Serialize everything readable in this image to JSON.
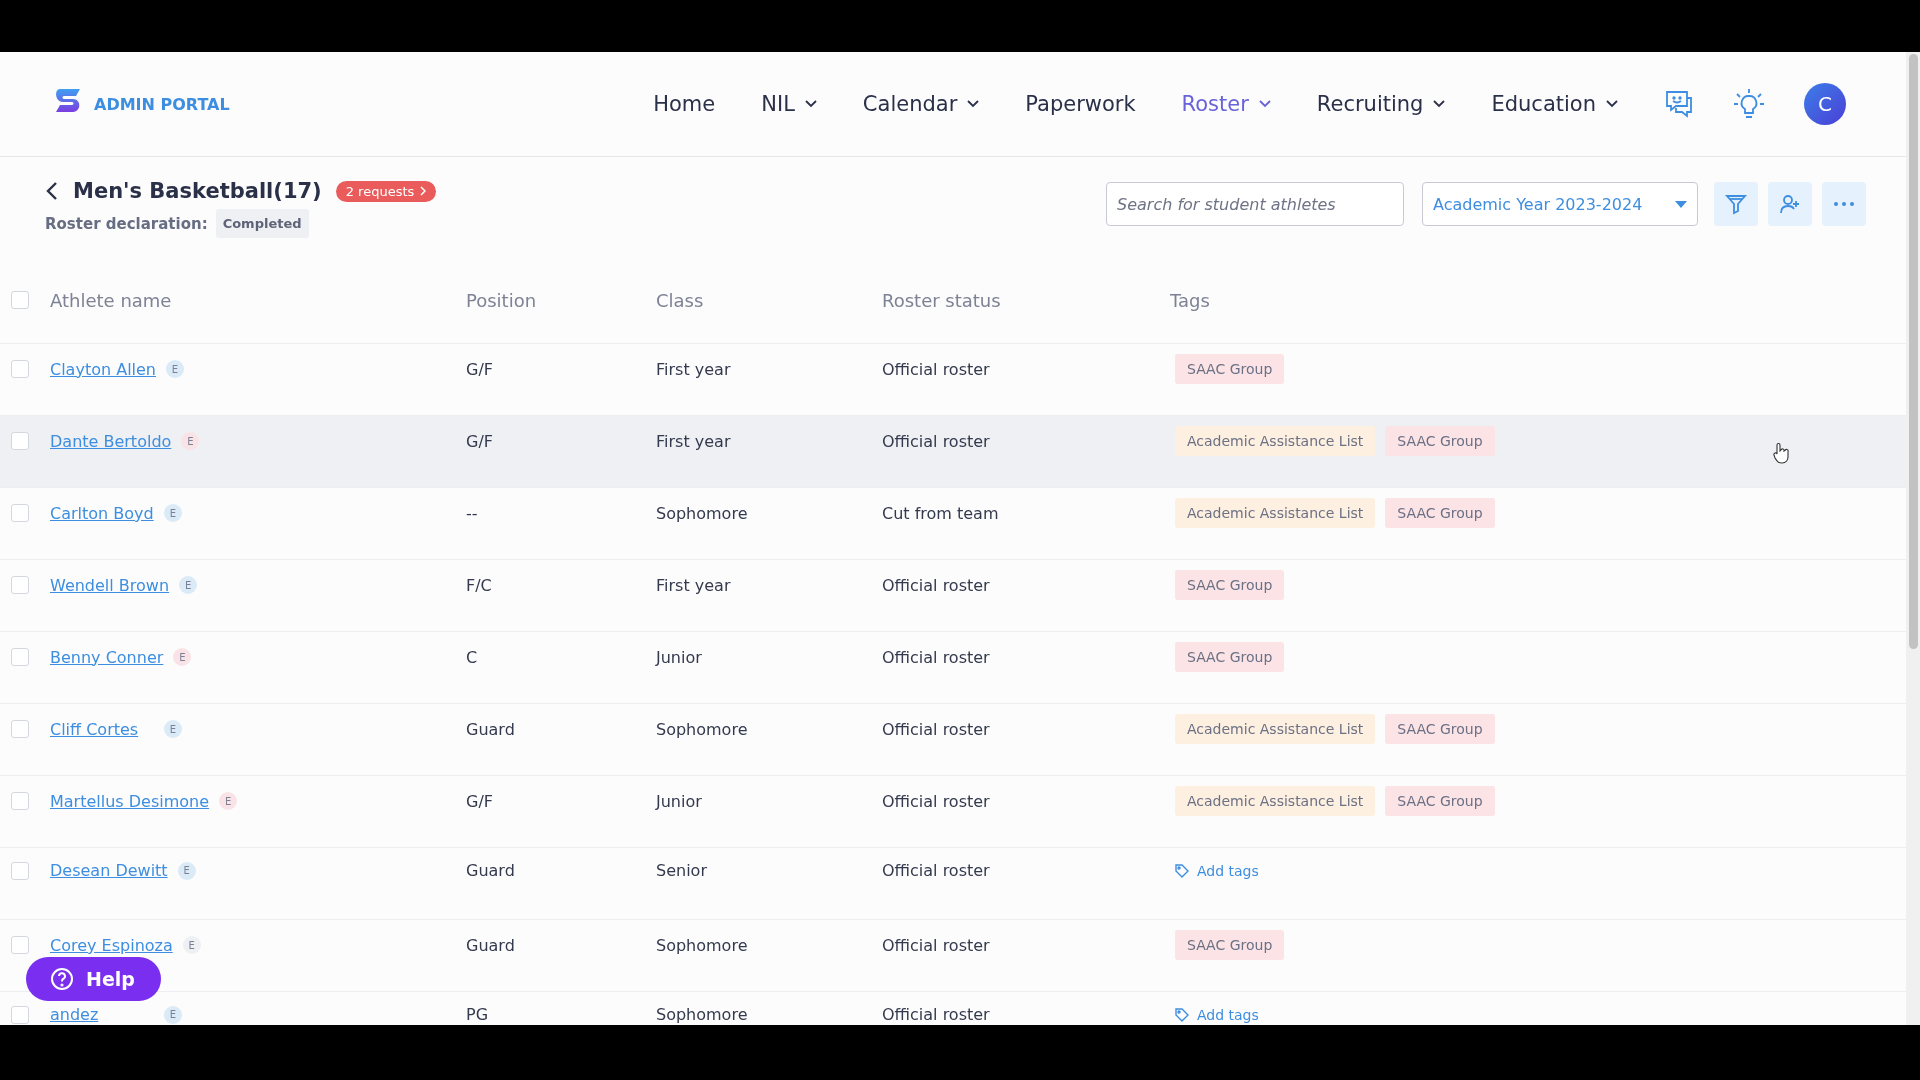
{
  "brand": {
    "name": "ADMIN PORTAL"
  },
  "nav": [
    {
      "label": "Home",
      "dropdown": false,
      "selected": false
    },
    {
      "label": "NIL",
      "dropdown": true,
      "selected": false
    },
    {
      "label": "Calendar",
      "dropdown": true,
      "selected": false
    },
    {
      "label": "Paperwork",
      "dropdown": false,
      "selected": false
    },
    {
      "label": "Roster",
      "dropdown": true,
      "selected": true
    },
    {
      "label": "Recruiting",
      "dropdown": true,
      "selected": false
    },
    {
      "label": "Education",
      "dropdown": true,
      "selected": false
    }
  ],
  "avatar": {
    "initial": "C"
  },
  "header": {
    "title": "Men's Basketball(17)",
    "requests": "2 requests",
    "declaration_label": "Roster declaration:",
    "declaration_status": "Completed"
  },
  "search": {
    "placeholder": "Search for student athletes"
  },
  "year_select": {
    "value": "Academic Year 2023-2024"
  },
  "table": {
    "select_all_checked": false,
    "columns": [
      "Athlete name",
      "Position",
      "Class",
      "Roster status",
      "Tags"
    ],
    "rows": [
      {
        "name": "Clayton Allen",
        "badge": {
          "text": "E",
          "color": "#dbeaf7"
        },
        "position": "G/F",
        "class": "First year",
        "status": "Official roster",
        "hovered": false,
        "checked": false,
        "tags": [
          {
            "label": "SAAC Group",
            "color": "#fbe3e6"
          }
        ]
      },
      {
        "name": "Dante Bertoldo",
        "badge": {
          "text": "E",
          "color": "#f9e3e6"
        },
        "position": "G/F",
        "class": "First year",
        "status": "Official roster",
        "hovered": true,
        "checked": false,
        "tags": [
          {
            "label": "Academic Assistance List",
            "color": "#fdf0e0"
          },
          {
            "label": "SAAC Group",
            "color": "#fbe3e6"
          }
        ]
      },
      {
        "name": "Carlton Boyd",
        "badge": {
          "text": "E",
          "color": "#dbeaf7"
        },
        "position": "--",
        "class": "Sophomore",
        "status": "Cut from team",
        "hovered": false,
        "checked": false,
        "tags": [
          {
            "label": "Academic Assistance List",
            "color": "#fdf0e0"
          },
          {
            "label": "SAAC Group",
            "color": "#fbe3e6"
          }
        ]
      },
      {
        "name": "Wendell Brown",
        "badge": {
          "text": "E",
          "color": "#dbeaf7"
        },
        "position": "F/C",
        "class": "First year",
        "status": "Official roster",
        "hovered": false,
        "checked": false,
        "tags": [
          {
            "label": "SAAC Group",
            "color": "#fbe3e6"
          }
        ]
      },
      {
        "name": "Benny Conner",
        "badge": {
          "text": "E",
          "color": "#f9e3e6"
        },
        "position": "C",
        "class": "Junior",
        "status": "Official roster",
        "hovered": false,
        "checked": false,
        "tags": [
          {
            "label": "SAAC Group",
            "color": "#fbe3e6"
          }
        ]
      },
      {
        "name": "Cliff Cortes",
        "badge": {
          "text": "E",
          "color": "#dbeaf7"
        },
        "position": "Guard",
        "class": "Sophomore",
        "status": "Official roster",
        "hovered": false,
        "checked": false,
        "tags": [
          {
            "label": "Academic Assistance List",
            "color": "#fdf0e0"
          },
          {
            "label": "SAAC Group",
            "color": "#fbe3e6"
          }
        ]
      },
      {
        "name": "Martellus Desimone",
        "badge": {
          "text": "E",
          "color": "#f9e3e6"
        },
        "position": "G/F",
        "class": "Junior",
        "status": "Official roster",
        "hovered": false,
        "checked": false,
        "tags": [
          {
            "label": "Academic Assistance List",
            "color": "#fdf0e0"
          },
          {
            "label": "SAAC Group",
            "color": "#fbe3e6"
          }
        ]
      },
      {
        "name": "Desean Dewitt",
        "badge": {
          "text": "E",
          "color": "#dbeaf7"
        },
        "position": "Guard",
        "class": "Senior",
        "status": "Official roster",
        "hovered": false,
        "checked": false,
        "tags": [],
        "add_tags": "Add tags"
      },
      {
        "name": "Corey Espinoza",
        "badge": {
          "text": "E",
          "color": "#eef0f3"
        },
        "position": "Guard",
        "class": "Sophomore",
        "status": "Official roster",
        "hovered": false,
        "checked": false,
        "tags": [
          {
            "label": "SAAC Group",
            "color": "#fbe3e6"
          }
        ]
      },
      {
        "name": "andez",
        "badge": {
          "text": "E",
          "color": "#dbeaf7"
        },
        "position": "PG",
        "class": "Sophomore",
        "status": "Official roster",
        "hovered": false,
        "checked": false,
        "tags": [],
        "add_tags": "Add tags"
      }
    ]
  },
  "help": {
    "label": "Help"
  }
}
